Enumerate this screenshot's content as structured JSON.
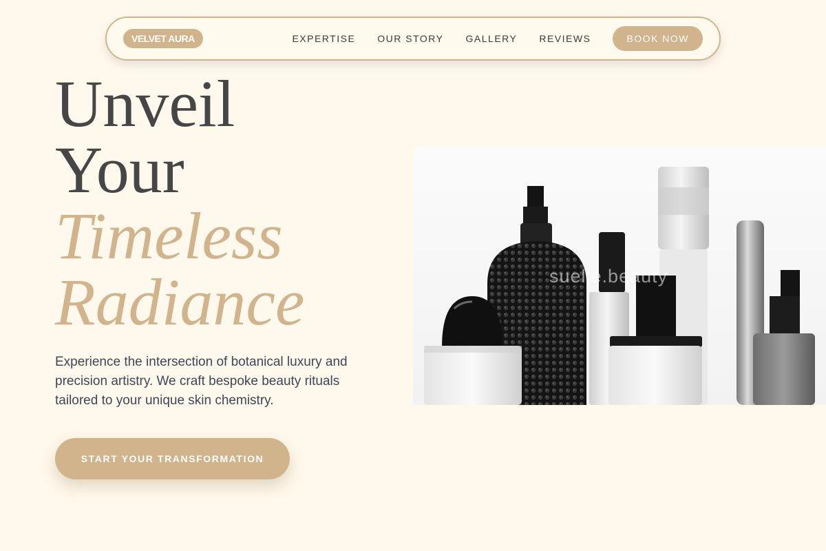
{
  "nav": {
    "logo": "VELVET AURA",
    "links": [
      "EXPERTISE",
      "OUR STORY",
      "GALLERY",
      "REVIEWS"
    ],
    "cta": "BOOK NOW"
  },
  "hero": {
    "headline": [
      "Unveil",
      "Your",
      "Timeless",
      "Radiance"
    ],
    "description": "Experience the intersection of botanical luxury and precision artistry. We craft bespoke beauty rituals tailored to your unique skin chemistry.",
    "cta": "START YOUR TRANSFORMATION",
    "image": {
      "watermark": "suelle.beauty"
    }
  },
  "colors": {
    "background": "#fef9ec",
    "accent": "#d2b48c",
    "heading": "#464646",
    "body_text": "#3f4656"
  }
}
